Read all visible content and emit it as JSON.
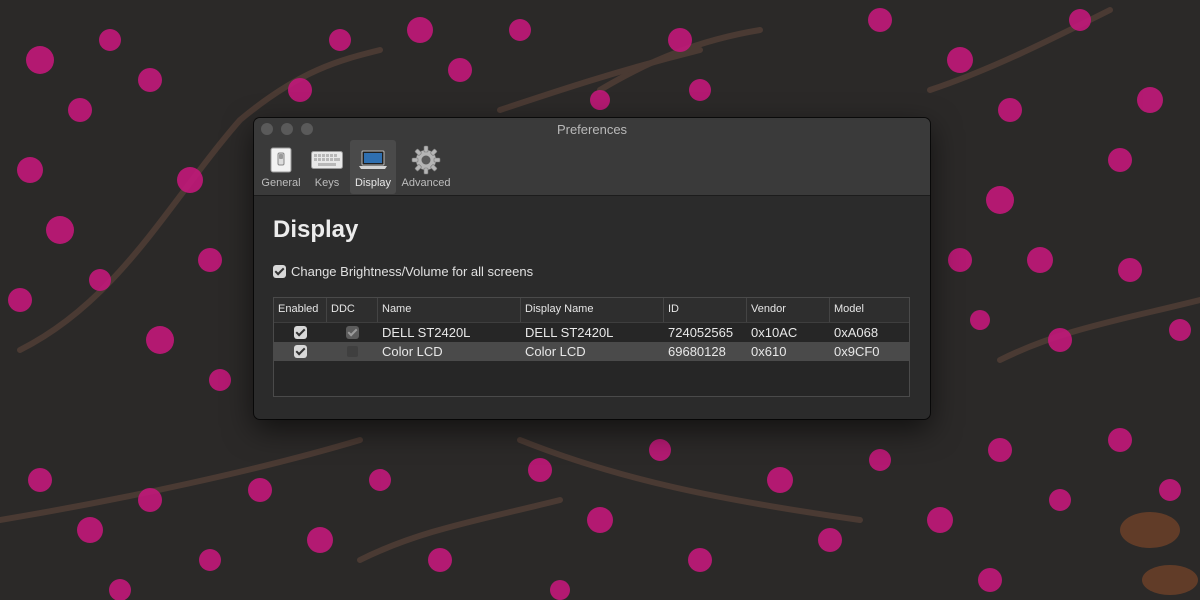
{
  "window": {
    "title": "Preferences"
  },
  "toolbar": {
    "items": [
      {
        "label": "General",
        "icon": "general-switch-icon"
      },
      {
        "label": "Keys",
        "icon": "keyboard-icon"
      },
      {
        "label": "Display",
        "icon": "laptop-display-icon",
        "selected": true
      },
      {
        "label": "Advanced",
        "icon": "gear-icon"
      }
    ]
  },
  "display": {
    "heading": "Display",
    "all_screens_label": "Change Brightness/Volume for all screens",
    "all_screens_checked": true
  },
  "table": {
    "columns": [
      "Enabled",
      "DDC",
      "Name",
      "Display Name",
      "ID",
      "Vendor",
      "Model"
    ],
    "rows": [
      {
        "enabled": true,
        "ddc": true,
        "name": "DELL ST2420L",
        "display_name": "DELL ST2420L",
        "id": "724052565",
        "vendor": "0x10AC",
        "model": "0xA068"
      },
      {
        "enabled": true,
        "ddc": false,
        "name": "Color LCD",
        "display_name": "Color LCD",
        "id": "69680128",
        "vendor": "0x610",
        "model": "0x9CF0"
      }
    ]
  },
  "colors": {
    "window_bg": "#2b2b2b",
    "toolbar_bg": "#3a3a3a",
    "selected_row": "#4a4a4a",
    "wallpaper_bg": "#2a2827",
    "blossom": "#c2187a"
  }
}
